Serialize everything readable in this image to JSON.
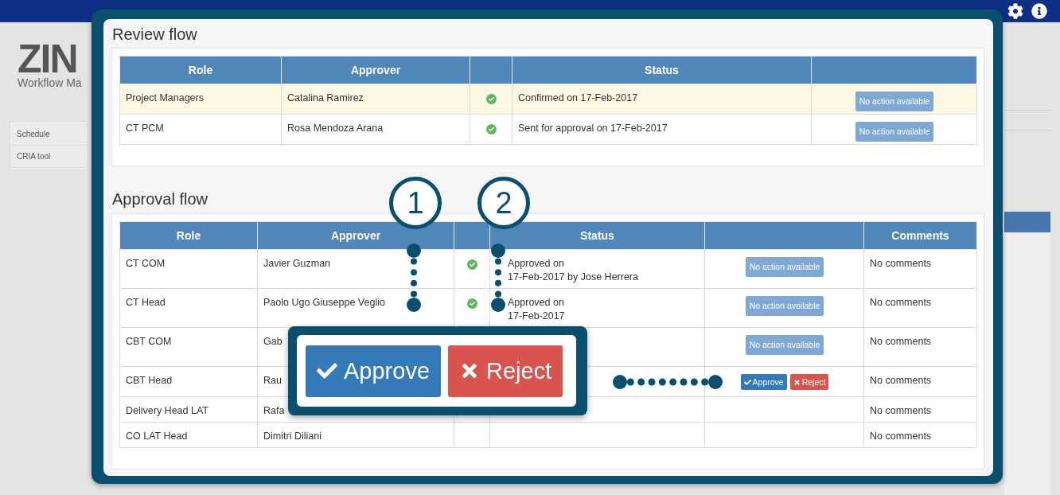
{
  "app": {
    "logo": "ZIN",
    "subtitle": "Workflow Ma",
    "menu": [
      {
        "label": "Schedule"
      },
      {
        "label": "CRIA tool"
      }
    ]
  },
  "review_flow": {
    "title": "Review flow",
    "columns": [
      "Role",
      "Approver",
      "",
      "Status",
      ""
    ],
    "rows": [
      {
        "role": "Project Managers",
        "approver": "Catalina Ramirez",
        "approved": true,
        "status": [
          "Confirmed on 17-Feb-2017"
        ],
        "action": {
          "kind": "badge",
          "label": "No action available"
        },
        "highlighted": true
      },
      {
        "role": "CT PCM",
        "approver": "Rosa Mendoza Arana",
        "approved": true,
        "status": [
          "Sent for approval on 17-Feb-2017"
        ],
        "action": {
          "kind": "badge",
          "label": "No action available"
        },
        "highlighted": false
      }
    ]
  },
  "approval_flow": {
    "title": "Approval flow",
    "columns": [
      "Role",
      "Approver",
      "",
      "Status",
      "",
      "Comments"
    ],
    "rows": [
      {
        "role": "CT COM",
        "approver": "Javier Guzman",
        "approved": true,
        "status": [
          "Approved on",
          "17-Feb-2017 by Jose Herrera"
        ],
        "action": {
          "kind": "badge",
          "label": "No action available"
        },
        "comments": "No comments"
      },
      {
        "role": "CT Head",
        "approver": "Paolo Ugo Giuseppe Veglio",
        "approved": true,
        "status": [
          "Approved on",
          "17-Feb-2017"
        ],
        "action": {
          "kind": "badge",
          "label": "No action available"
        },
        "comments": "No comments"
      },
      {
        "role": "CBT COM",
        "approver": "Gab",
        "status": [],
        "action": {
          "kind": "badge",
          "label": "No action available"
        },
        "comments": "No comments"
      },
      {
        "role": "CBT Head",
        "approver": "Rau",
        "status": [],
        "action": {
          "kind": "decision",
          "approve": "Approve",
          "reject": "Reject"
        },
        "comments": "No comments"
      },
      {
        "role": "Delivery Head LAT",
        "approver": "Rafa",
        "approved": false,
        "status": [],
        "action": {
          "kind": "none"
        },
        "comments": "No comments"
      },
      {
        "role": "CO LAT Head",
        "approver": "Dimitri Diliani",
        "approved": false,
        "status": [],
        "action": {
          "kind": "none"
        },
        "comments": "No comments"
      }
    ]
  },
  "callouts": [
    {
      "number": "1"
    },
    {
      "number": "2"
    }
  ],
  "zoom_popup": {
    "approve": "Approve",
    "reject": "Reject"
  }
}
